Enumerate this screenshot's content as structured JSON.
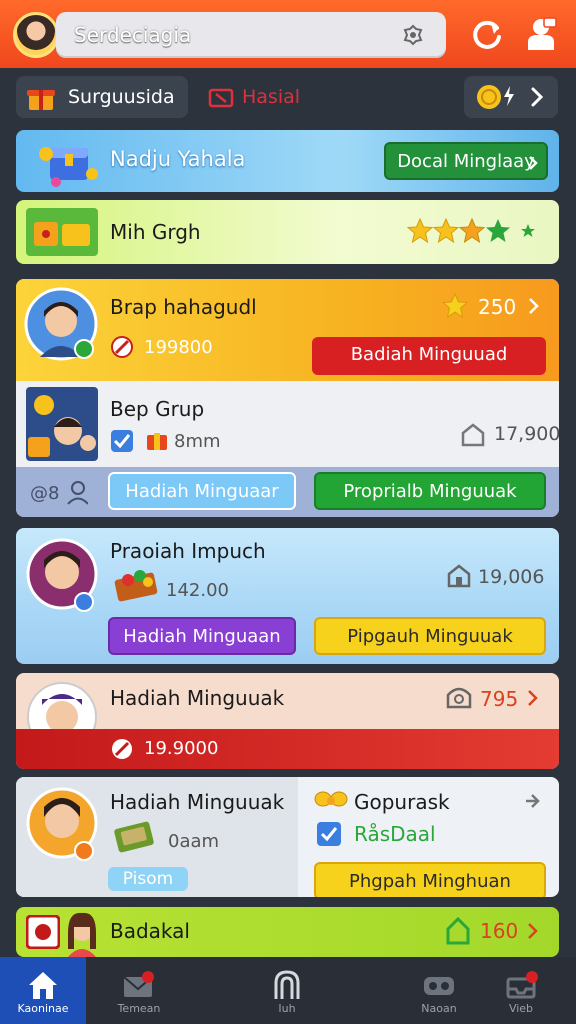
{
  "header": {
    "search_text": "Serdeciagia",
    "icons": [
      "avatar",
      "search-icon",
      "refresh-icon",
      "user-icon"
    ]
  },
  "tabs": [
    {
      "label": "Surguusida",
      "icon": "gift-icon"
    },
    {
      "label": "Hasial",
      "icon": "ticket-icon"
    },
    {
      "label": "",
      "icon": "coin-icon"
    }
  ],
  "cards": {
    "banner": {
      "title": "Nadju Yahala",
      "button": "Docal Minglaay"
    },
    "group": {
      "title": "Mih Grgh",
      "stars": 3
    },
    "weekly": {
      "title": "Brap hahagudl",
      "value": "199800",
      "points": "250",
      "button": "Badiah Minguuad",
      "sub": {
        "title": "Bep Grup",
        "meta": "8mm",
        "count": "17,900"
      },
      "left_button": "Hadiah Minguaar",
      "right_button": "Proprialb Minguuak",
      "footer_icons": "@8"
    },
    "invite": {
      "title": "Praoiah Impuch",
      "value": "142.00",
      "count": "19,006",
      "left_button": "Hadiah Minguaan",
      "right_button": "Pipgauh Minguuak"
    },
    "reward": {
      "title": "Hadiah Minguuak",
      "points": "795",
      "band_value": "19.9000"
    },
    "split": {
      "left_title": "Hadiah Minguuak",
      "left_meta": "0aam",
      "left_tag": "Pisom",
      "right_title": "Gopurask",
      "right_check": "RåsDaal",
      "right_button": "Phgpah Minghuan"
    },
    "last": {
      "title": "Badakal",
      "points": "160"
    }
  },
  "nav": [
    {
      "label": "Kaoninae",
      "icon": "home-icon",
      "active": true
    },
    {
      "label": "Temean",
      "icon": "mail-icon",
      "active": false
    },
    {
      "label": "Iuh",
      "icon": "magnet-icon",
      "active": false
    },
    {
      "label": "Naoan",
      "icon": "gamepad-icon",
      "active": false
    },
    {
      "label": "Vieb",
      "icon": "tray-icon",
      "active": false
    }
  ],
  "colors": {
    "accent": "#f0471d",
    "primary": "#1d4fb6",
    "red": "#c3191a",
    "green": "#2aa63a",
    "yellow": "#fcd43a",
    "purple": "#8a3fd4"
  }
}
